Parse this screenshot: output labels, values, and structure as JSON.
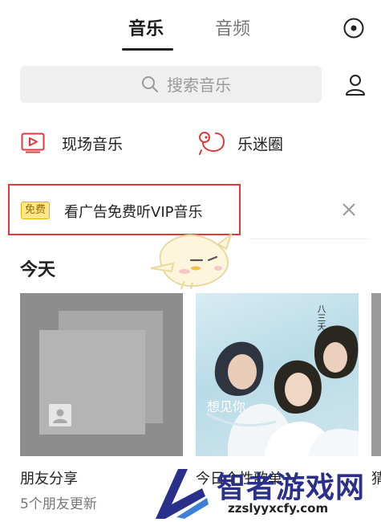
{
  "header": {
    "tabs": [
      {
        "label": "音乐",
        "active": true
      },
      {
        "label": "音频",
        "active": false
      }
    ]
  },
  "search": {
    "placeholder": "搜索音乐"
  },
  "shortcuts": [
    {
      "label": "现场音乐",
      "icon": "play-box-icon"
    },
    {
      "label": "乐迷圈",
      "icon": "chat-bubbles-icon"
    }
  ],
  "promo": {
    "badge": "免费",
    "text": "看广告免费听VIP音乐"
  },
  "section": {
    "title": "今天"
  },
  "cards": [
    {
      "title": "朋友分享",
      "subtitle": "5个朋友更新"
    },
    {
      "title": "今日个性歌单"
    },
    {
      "title": "猜"
    }
  ],
  "album_cover": {
    "text_main": "想见你",
    "text_side": "八三夭"
  },
  "watermark": {
    "name": "智者游戏网",
    "url": "zzslyyxcfy.com"
  },
  "colors": {
    "accent_red": "#e23a3a",
    "badge_yellow": "#ffe78a",
    "watermark_blue": "#2a2f8a"
  }
}
